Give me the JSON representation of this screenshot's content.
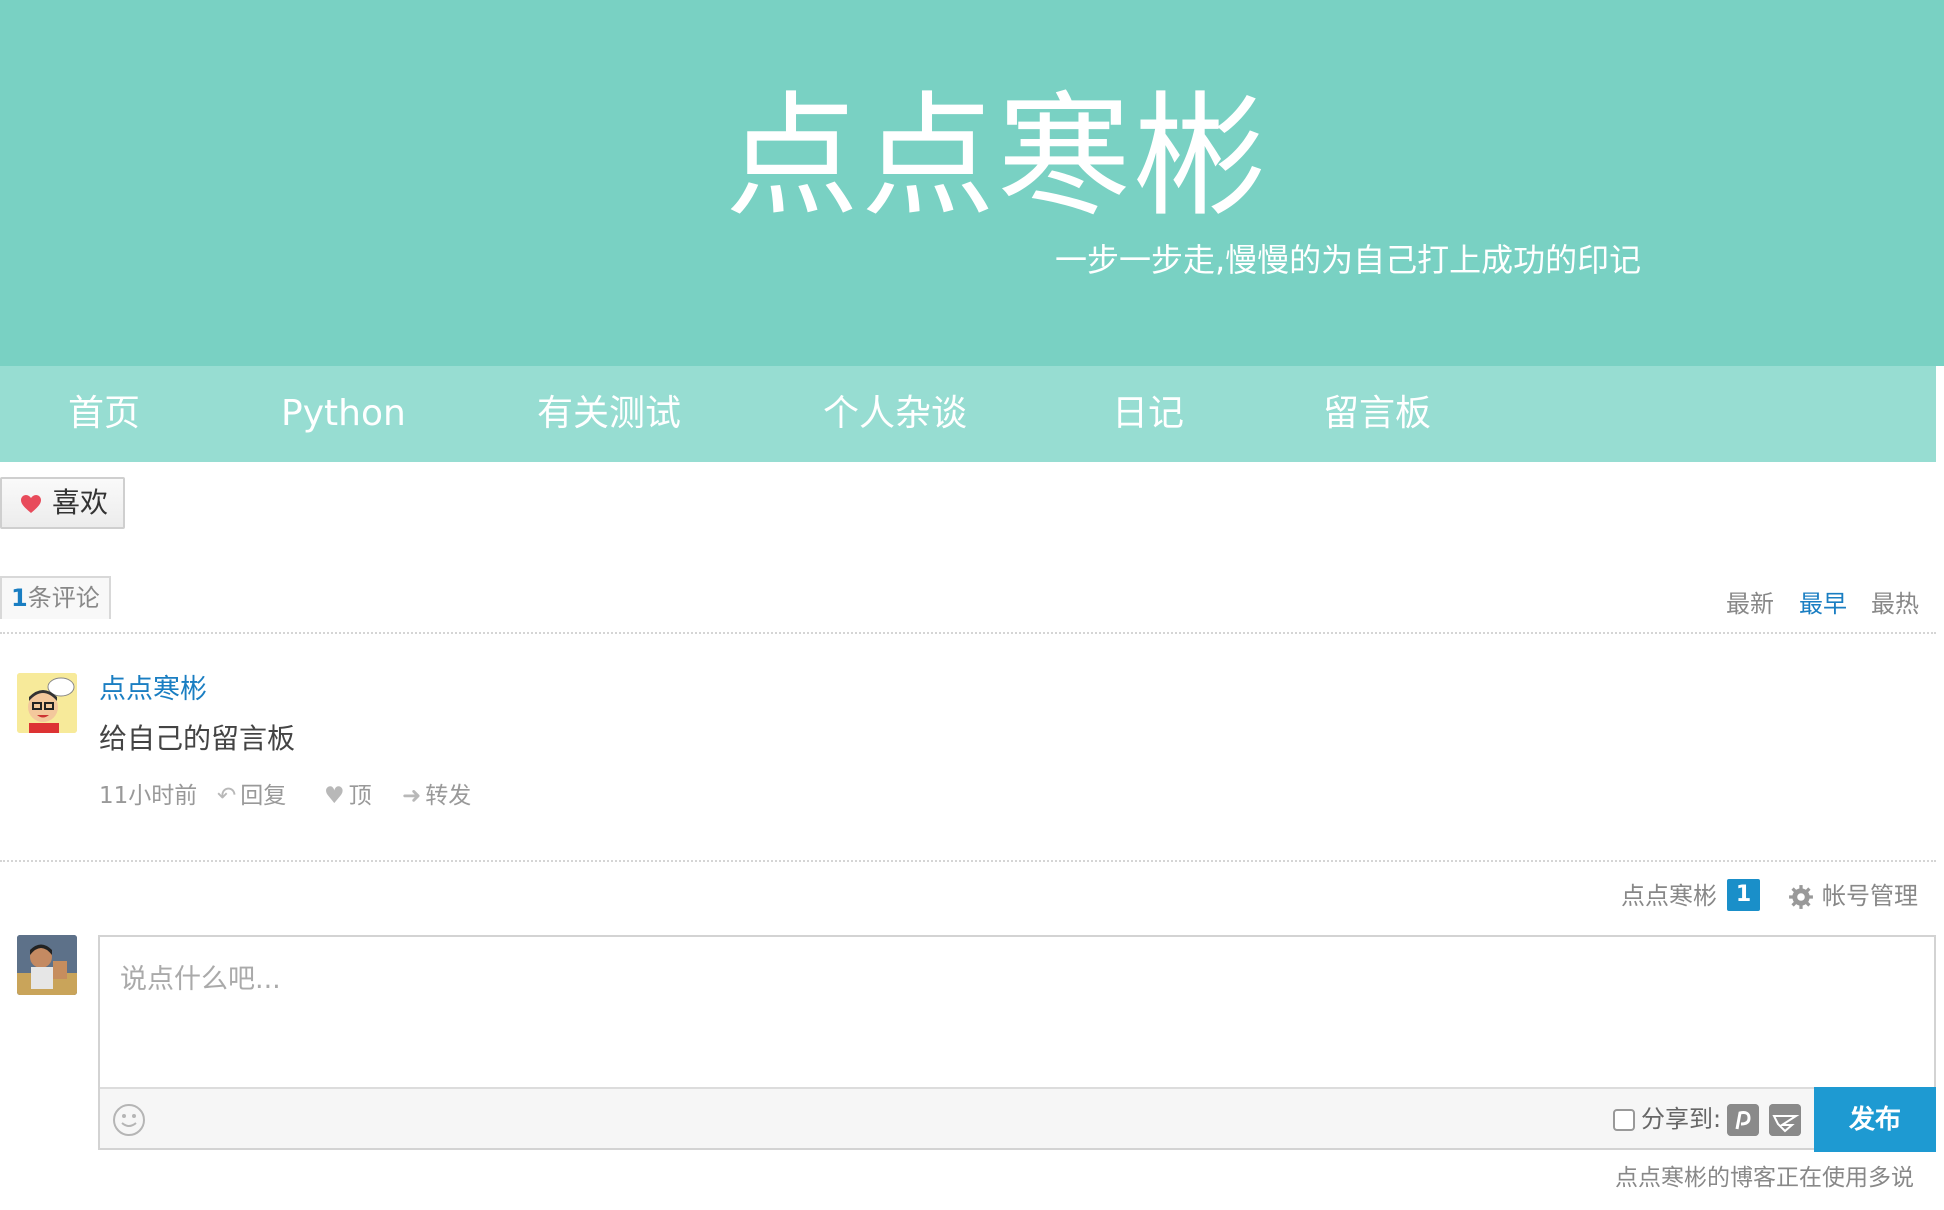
{
  "site": {
    "title": "点点寒彬",
    "subtitle": "一步一步走,慢慢的为自己打上成功的印记"
  },
  "nav": {
    "items": [
      {
        "label": "首页"
      },
      {
        "label": "Python"
      },
      {
        "label": "有关测试"
      },
      {
        "label": "个人杂谈"
      },
      {
        "label": "日记"
      },
      {
        "label": "留言板"
      }
    ]
  },
  "like": {
    "label": "喜欢",
    "icon": "heart-icon",
    "color": "#e84b5b"
  },
  "comments": {
    "count": "1",
    "count_suffix": "条评论",
    "sort": [
      "最新",
      "最早",
      "最热"
    ],
    "active_sort": "最早",
    "items": [
      {
        "author": "点点寒彬",
        "text": "给自己的留言板",
        "time": "11小时前",
        "reply": "回复",
        "upvote": "顶",
        "forward": "转发"
      }
    ]
  },
  "user_bar": {
    "name": "点点寒彬",
    "badge": "1",
    "account": "帐号管理"
  },
  "composer": {
    "placeholder": "说点什么吧...",
    "share_label": "分享到:",
    "share_targets": [
      "diandian-icon",
      "qzone-icon"
    ],
    "publish_label": "发布"
  },
  "footer": {
    "powered_by": "点点寒彬的博客正在使用多说"
  },
  "colors": {
    "header": "#79d1c3",
    "nav": "#97ddd2",
    "link": "#1a7ec2",
    "publish": "#1e9ad2"
  }
}
